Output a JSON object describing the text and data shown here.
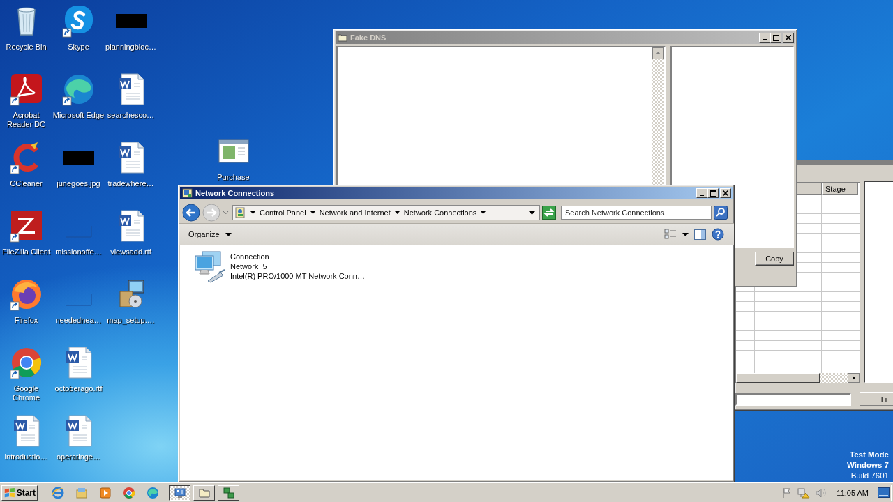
{
  "desktop_icons": [
    {
      "label": "Recycle Bin",
      "kind": "recycle",
      "shortcut": false
    },
    {
      "label": "Acrobat Reader DC",
      "kind": "acrobat",
      "shortcut": true
    },
    {
      "label": "CCleaner",
      "kind": "ccleaner",
      "shortcut": true
    },
    {
      "label": "FileZilla Client",
      "kind": "filezilla",
      "shortcut": true
    },
    {
      "label": "Firefox",
      "kind": "firefox",
      "shortcut": true
    },
    {
      "label": "Google Chrome",
      "kind": "chrome",
      "shortcut": true
    },
    {
      "label": "introductio…",
      "kind": "word",
      "shortcut": false
    },
    {
      "label": "Skype",
      "kind": "skype",
      "shortcut": true
    },
    {
      "label": "Microsoft Edge",
      "kind": "edge",
      "shortcut": true
    },
    {
      "label": "junegoes.jpg",
      "kind": "redacted",
      "shortcut": false
    },
    {
      "label": "missionoffe…",
      "kind": "blank",
      "shortcut": false
    },
    {
      "label": "needednea…",
      "kind": "blank",
      "shortcut": false
    },
    {
      "label": "octoberago.rtf",
      "kind": "word",
      "shortcut": false
    },
    {
      "label": "operatinge…",
      "kind": "word",
      "shortcut": false
    },
    {
      "label": "planningbloc…",
      "kind": "redacted",
      "shortcut": false
    },
    {
      "label": "searchesco…",
      "kind": "word",
      "shortcut": false
    },
    {
      "label": "tradewhere…",
      "kind": "word",
      "shortcut": false
    },
    {
      "label": "viewsadd.rtf",
      "kind": "word",
      "shortcut": false
    },
    {
      "label": "map_setup.…",
      "kind": "installer",
      "shortcut": false
    }
  ],
  "loose_icon": {
    "label": "Purchase",
    "kind": "windowdoc",
    "shortcut": false
  },
  "background_window": {
    "active": false,
    "columns": [
      {
        "label": "Stage"
      }
    ],
    "button": "Li"
  },
  "fake_dns": {
    "title": "Fake DNS",
    "active": false,
    "copy_button": "Copy"
  },
  "network_connections": {
    "title": "Network Connections",
    "active": true,
    "breadcrumb": [
      "Control Panel",
      "Network and Internet",
      "Network Connections"
    ],
    "search": {
      "placeholder": "Search Network Connections"
    },
    "organize": "Organize",
    "items": [
      {
        "name": "Connection",
        "network": "Network  5",
        "adapter": "Intel(R) PRO/1000 MT Network Conn…"
      }
    ]
  },
  "system_watermark": [
    "Test Mode",
    "Windows 7",
    "Build 7601"
  ],
  "taskbar": {
    "start": "Start",
    "pinned": [
      {
        "kind": "ie"
      },
      {
        "kind": "explorer"
      },
      {
        "kind": "media"
      },
      {
        "kind": "chrome"
      },
      {
        "kind": "edge"
      }
    ],
    "tasks": [
      {
        "kind": "network",
        "selected": true
      },
      {
        "kind": "folder",
        "selected": false
      },
      {
        "kind": "dns",
        "selected": false
      }
    ],
    "clock": "11:05 AM"
  }
}
